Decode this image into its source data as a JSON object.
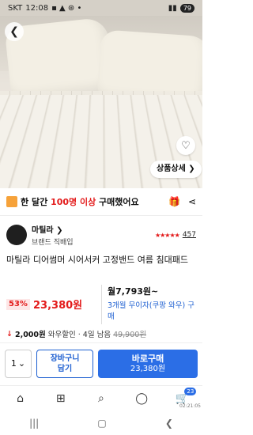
{
  "status_bar": {
    "carrier": "SKT",
    "time": "12:08",
    "battery": "79"
  },
  "product_image": {
    "back_icon": "chevron-left-icon",
    "wishlist_icon": "heart-outline-icon",
    "detail_button": "상품상세 ❯"
  },
  "buy_banner": {
    "text_pre": "한 달간",
    "count": "100명 이상",
    "text_post": "구매했어요"
  },
  "seller": {
    "name": "마틸라 ❯",
    "subtitle": "브랜드 직배입",
    "rating_stars": "★★★★★",
    "review_count": "457"
  },
  "product": {
    "title": "마틸라 디어썸머 시어서커 고정밴드 여름 침대패드"
  },
  "price": {
    "discount": "53%",
    "sale_price": "23,380원",
    "monthly": "월7,793원~",
    "installment_blue": "3개월 무이자(쿠팡 와우)",
    "installment_tail": "구매"
  },
  "coupon": {
    "amount": "2,000원",
    "label": "와우할인 · 4일 남음",
    "original": "49,900원"
  },
  "buy_bar": {
    "quantity": "1",
    "cart_line1": "장바구니",
    "cart_line2": "담기",
    "buy_label": "바로구매",
    "buy_price": "23,380원"
  },
  "bottom_nav": {
    "cart_badge": "23",
    "time": "02:21:05"
  }
}
